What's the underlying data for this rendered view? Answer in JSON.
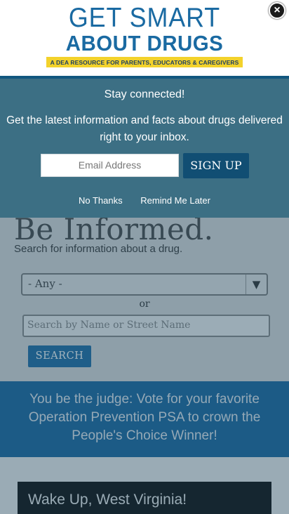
{
  "header": {
    "logo_line1": "GET SMART",
    "logo_line2": "ABOUT DRUGS",
    "logo_tagline": "A DEA RESOURCE FOR PARENTS, EDUCATORS & CAREGIVERS",
    "close_symbol": "×",
    "close_icon": "close-icon"
  },
  "popup": {
    "title": "Stay connected!",
    "text": "Get the latest information and facts about drugs delivered right to your inbox.",
    "email_placeholder": "Email Address",
    "signup_label": "SIGN UP",
    "no_thanks_label": "No Thanks",
    "remind_later_label": "Remind Me Later"
  },
  "informed": {
    "title": "Be Informed.",
    "subtitle": "Search for information about a drug.",
    "select_value": "- Any -",
    "select_arrow": "▼",
    "or_text": "or",
    "search_placeholder": "Search by Name or Street Name",
    "search_button": "SEARCH"
  },
  "vote_banner": {
    "text": "You be the judge: Vote for your favorite Operation Prevention PSA to crown the People's Choice Winner!"
  },
  "video": {
    "title": "Wake Up, West Virginia!"
  },
  "colors": {
    "brand_blue": "#1a6aa2",
    "tagline_yellow": "#f3d22b",
    "popup_bg": "#3c6f84",
    "signup_button": "#114e73"
  }
}
